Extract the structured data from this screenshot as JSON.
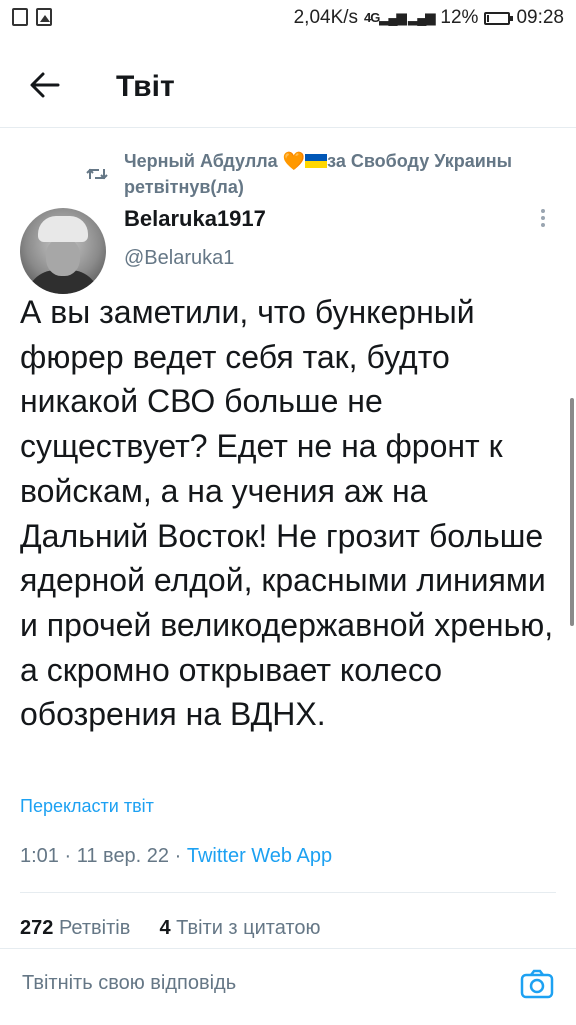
{
  "status_bar": {
    "speed": "2,04K/s",
    "network": "4G",
    "battery": "12%",
    "battery_level": 0.12,
    "time": "09:28",
    "icons": [
      "notification-box-icon",
      "image-icon",
      "signal-icon",
      "battery-icon"
    ]
  },
  "header": {
    "title": "Твіт",
    "back_icon": "arrow-left-icon"
  },
  "retweet": {
    "icon": "retweet-icon",
    "user_part1": "Черный Абдулла ",
    "heart": "🧡",
    "user_part2": "за Свободу Украины",
    "label": "ретвітнув(ла)"
  },
  "author": {
    "name": "Belaruka1917",
    "handle": "@Belaruka1"
  },
  "tweet": {
    "text": "А вы заметили, что бункерный фюрер ведет себя так, будто никакой СВО больше не существует? Едет не на фронт к войскам, а на учения аж на Дальний Восток! Не грозит больше ядерной елдой, красными линиями и прочей великодержавной хренью, а скромно открывает колесо обозрения на ВДНХ.",
    "translate_label": "Перекласти твіт",
    "time": "1:01",
    "date": "11 вер. 22",
    "separator": " · ",
    "app": "Twitter Web App"
  },
  "stats": {
    "retweets_count": "272",
    "retweets_label": "Ретвітів",
    "quotes_count": "4",
    "quotes_label": "Твіти з цитатою"
  },
  "reply": {
    "placeholder": "Твітніть свою відповідь",
    "camera_icon": "camera-icon"
  },
  "colors": {
    "accent": "#1da1f2",
    "secondary_text": "#657786",
    "text": "#14171a"
  }
}
